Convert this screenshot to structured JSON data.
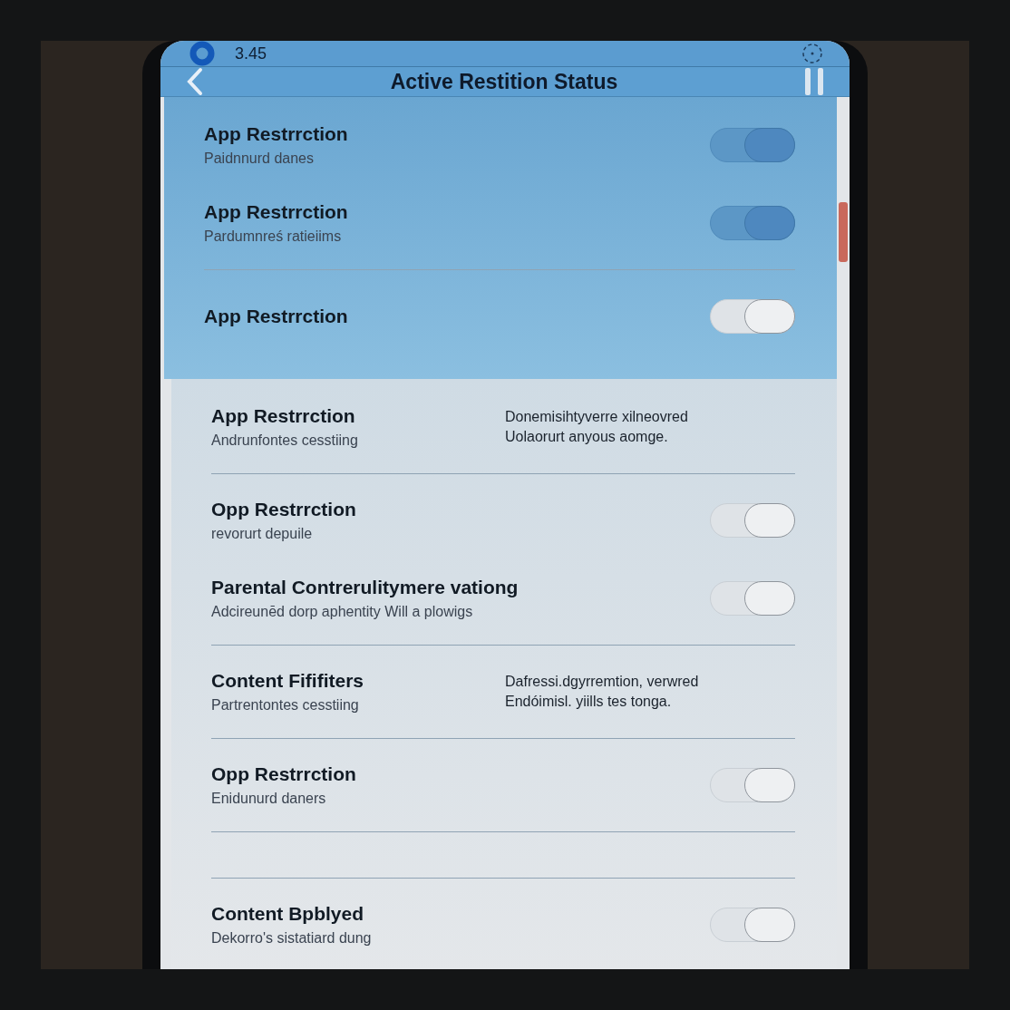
{
  "status_bar": {
    "time": "3.45"
  },
  "nav_bar": {
    "title": "Active Restition Status"
  },
  "sections": [
    {
      "kind": "highlighted",
      "rows": [
        {
          "kind": "toggle",
          "title": "App Restrrction",
          "subtitle": "Paidnnurd danes",
          "on": true,
          "divider": false,
          "extra_divider": false
        },
        {
          "kind": "toggle",
          "title": "App Restrrction",
          "subtitle": "Pardumnreś ratieiims",
          "on": true,
          "divider": true,
          "extra_divider": false
        },
        {
          "kind": "toggle",
          "title": "App Restrrction",
          "on": false,
          "divider": false,
          "extra_divider": false
        }
      ]
    },
    {
      "kind": "plain",
      "rows": [
        {
          "kind": "note",
          "title": "App Restrrction",
          "subtitle": "Andrunfontes cesstiing",
          "note": [
            "Donemisihtyverre xilneovred",
            "Uolaorurt anyous aomge."
          ],
          "divider": true,
          "extra_divider": false
        },
        {
          "kind": "toggle",
          "title": "Opp Restrrction",
          "subtitle": "revorurt depuile",
          "on": false,
          "divider": false,
          "extra_divider": false
        },
        {
          "kind": "toggle",
          "title": "Parental Contrerulitymere vationg",
          "subtitle": "Adcireunēd dorp aphentity Will a plowigs",
          "on": false,
          "divider": true,
          "extra_divider": false
        },
        {
          "kind": "note",
          "title": "Content Fififiters",
          "subtitle": "Partrentontes cesstiing",
          "note": [
            "Dafressi.dgyrremtion, verwred",
            "Endóimisl. yiills tes tonga."
          ],
          "divider": true,
          "extra_divider": false
        },
        {
          "kind": "toggle",
          "title": "Opp Restrrction",
          "subtitle": "Enidunurd daners",
          "on": false,
          "divider": true,
          "extra_divider": true
        },
        {
          "kind": "toggle",
          "title": "Content Bpblyed",
          "subtitle": "Dekorro's sistatiard dung",
          "on": false,
          "divider": false,
          "extra_divider": false
        }
      ]
    }
  ]
}
